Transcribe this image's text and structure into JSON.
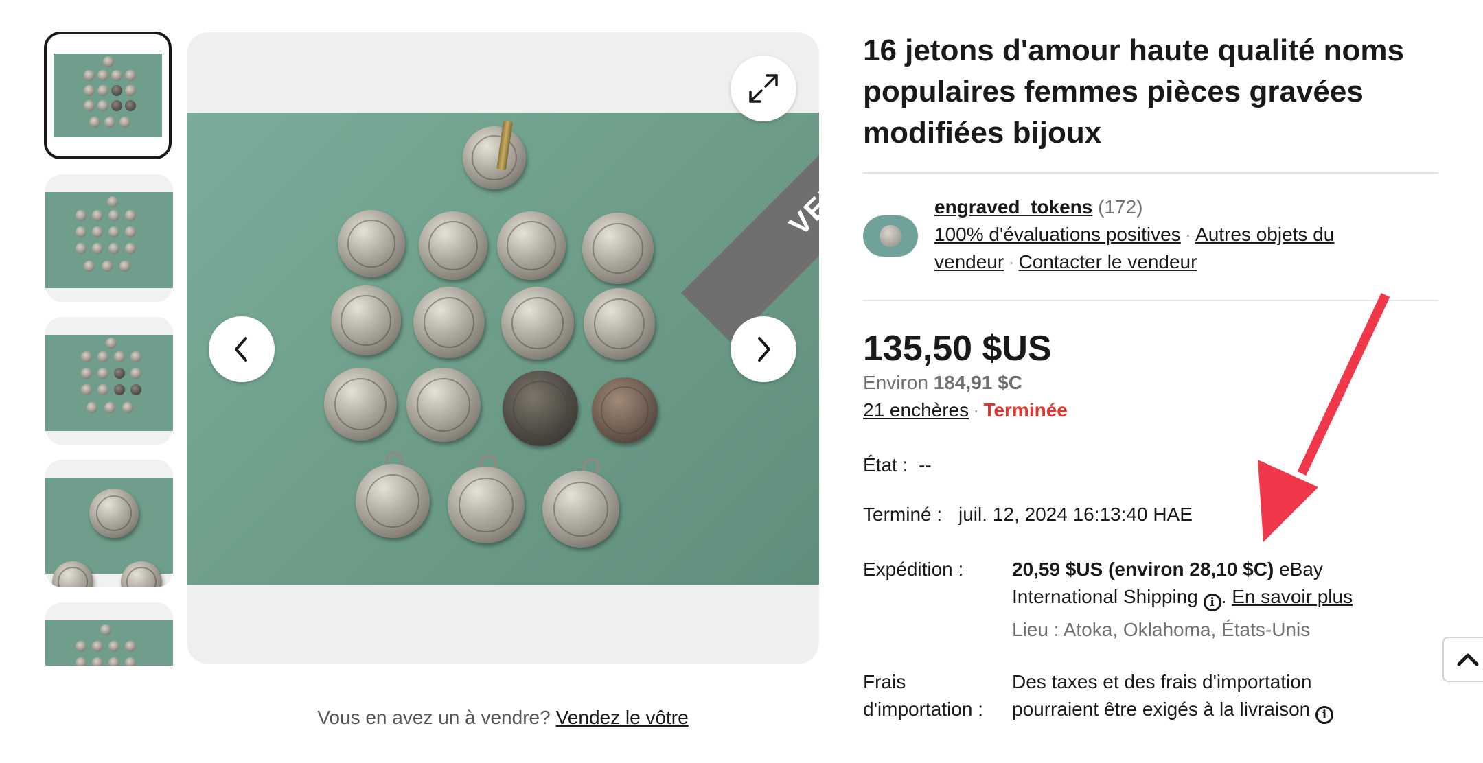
{
  "listing": {
    "title": "16 jetons d'amour haute qualité noms populaires femmes pièces gravées modifiées bijoux",
    "image_badge": "VENDU"
  },
  "seller": {
    "name": "engraved_tokens",
    "feedback_count": "(172)",
    "positive_link": "100% d'évaluations positives",
    "other_items_link": "Autres objets du vendeur",
    "contact_link": "Contacter le vendeur"
  },
  "pricing": {
    "price": "135,50 $US",
    "approx_prefix": "Environ",
    "approx_value": "184,91 $C",
    "bids_link": "21 enchères",
    "status": "Terminée",
    "status_color": "#e0362c"
  },
  "details": {
    "condition_label": "État :",
    "condition_value": "--",
    "ended_label": "Terminé :",
    "ended_value": "juil. 12, 2024 16:13:40 HAE",
    "shipping_label": "Expédition :",
    "shipping_price": "20,59 $US (environ 28,10 $C)",
    "shipping_service": "eBay International Shipping",
    "learn_more": "En savoir plus",
    "location": "Lieu : Atoka, Oklahoma, États-Unis",
    "import_label_1": "Frais",
    "import_label_2": "d'importation :",
    "import_value_1": "Des taxes et des frais d'importation",
    "import_value_2": "pourraient être exigés à la livraison"
  },
  "sell": {
    "prompt": "Vous en avez un à vendre?",
    "link": "Vendez le vôtre"
  },
  "annotation": {
    "arrow_color": "#f0384a"
  },
  "icons": [
    "expand-icon",
    "chevron-left-icon",
    "chevron-right-icon",
    "info-icon",
    "chevron-up-icon"
  ]
}
